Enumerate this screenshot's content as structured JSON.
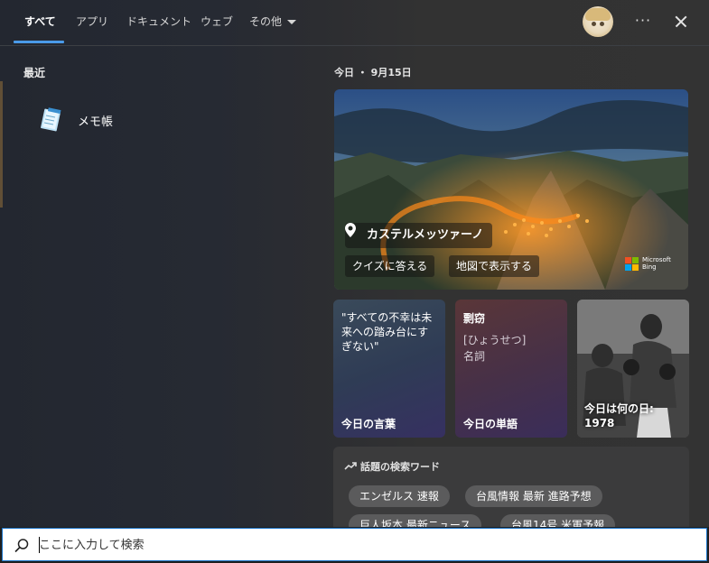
{
  "nav": {
    "tabs": [
      {
        "label": "すべて",
        "active": true
      },
      {
        "label": "アプリ"
      },
      {
        "label": "ドキュメント"
      },
      {
        "label": "ウェブ"
      },
      {
        "label": "その他"
      }
    ],
    "more_label": "···",
    "accent_color": "#4a9ae8"
  },
  "left": {
    "recent_title": "最近",
    "recent_items": [
      {
        "label": "メモ帳",
        "icon": "notepad-icon"
      }
    ]
  },
  "right": {
    "today_label": "今日 ・ 9月15日",
    "hero": {
      "title": "カステルメッツァーノ",
      "quiz_button": "クイズに答える",
      "map_button": "地図で表示する",
      "brand_line1": "Microsoft",
      "brand_line2": "Bing"
    },
    "cards": {
      "quote_text": "\"すべての不幸は未来への踏み台にすぎない\"",
      "quote_label": "今日の言葉",
      "word": "剽窃",
      "word_reading": "[ひょうせつ]",
      "word_pos": "名詞",
      "word_label": "今日の単語",
      "history_label": "今日は何の日:",
      "history_year": "1978"
    },
    "trending": {
      "title": "話題の検索ワード",
      "chips": [
        "エンゼルス 速報",
        "台風情報 最新 進路予想",
        "巨人坂本 最新ニュース",
        "台風14号 米軍予報"
      ]
    }
  },
  "search": {
    "placeholder": "ここに入力して検索"
  }
}
